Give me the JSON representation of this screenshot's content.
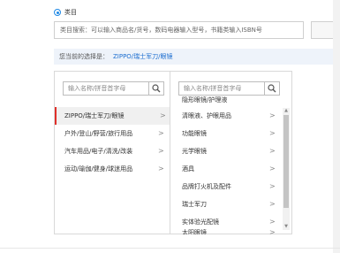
{
  "category_option": {
    "label": "类目"
  },
  "search": {
    "placeholder": "类目搜索：可以输入商品名/货号，数码电器输入型号，书籍类输入ISBN号"
  },
  "selection": {
    "label": "您当前的选择是：",
    "value": "ZIPPO/瑞士军刀/眼镜"
  },
  "left_column": {
    "search_placeholder": "输入名称/拼音首字母",
    "items": [
      {
        "label": "ZIPPO/瑞士军刀/眼镜",
        "selected": true
      },
      {
        "label": "户外/登山/野营/旅行用品",
        "selected": false
      },
      {
        "label": "汽车用品/电子/清洗/改装",
        "selected": false
      },
      {
        "label": "运动/瑜伽/健身/球迷用品",
        "selected": false
      }
    ]
  },
  "right_column": {
    "search_placeholder": "输入名称/拼音首字母",
    "items": [
      {
        "label": "隐形眼镜/护理液"
      },
      {
        "label": "清眼液、护眼用品"
      },
      {
        "label": "功能眼镜"
      },
      {
        "label": "光学眼镜"
      },
      {
        "label": "酒具"
      },
      {
        "label": "品牌打火机及配件"
      },
      {
        "label": "瑞士军刀"
      },
      {
        "label": "实体验光配镜"
      },
      {
        "label": "太阳眼镜"
      }
    ]
  },
  "icons": {
    "search": "search-icon",
    "chevron": "chevron-right-icon"
  },
  "colors": {
    "accent": "#1e88e5",
    "link": "#1e6fd0",
    "selected_marker": "#e0302a"
  }
}
